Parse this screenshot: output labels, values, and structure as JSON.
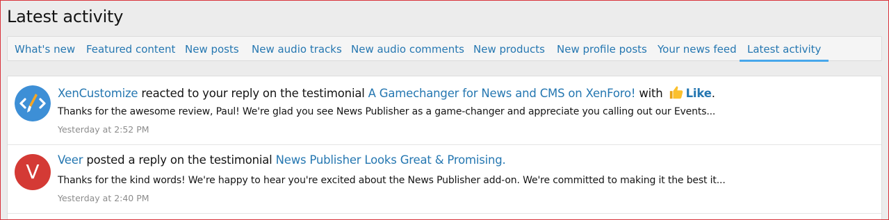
{
  "page": {
    "title": "Latest activity"
  },
  "tabs": [
    {
      "label": "What's new"
    },
    {
      "label": "Featured content"
    },
    {
      "label": "New posts"
    },
    {
      "label": "New audio tracks"
    },
    {
      "label": "New audio comments"
    },
    {
      "label": "New products"
    },
    {
      "label": "New profile posts"
    },
    {
      "label": "Your news feed"
    },
    {
      "label": "Latest activity",
      "active": true
    }
  ],
  "items": [
    {
      "user": "XenCustomize",
      "action": " reacted to your reply on the testimonial ",
      "thread": "A Gamechanger for News and CMS on XenForo!",
      "with": " with ",
      "reaction": "Like",
      "end": ".",
      "snippet": "Thanks for the awesome review, Paul! We're glad you see News Publisher as a game-changer and appreciate you calling out our Events...",
      "time": "Yesterday at 2:52 PM",
      "avatar_icon": "code-brush-icon",
      "avatar_color": "#3d8fd6"
    },
    {
      "user": "Veer",
      "avatar_letter": "V",
      "action": " posted a reply on the testimonial ",
      "thread": "News Publisher Looks Great & Promising.",
      "snippet": "Thanks for the kind words! We're happy to hear you're excited about the News Publisher add-on. We're committed to making it the best it...",
      "time": "Yesterday at 2:40 PM",
      "avatar_color": "#d43a35"
    }
  ],
  "colors": {
    "link": "#2577b1",
    "tab_active_underline": "#47a7eb",
    "muted": "#8c8c8c"
  }
}
